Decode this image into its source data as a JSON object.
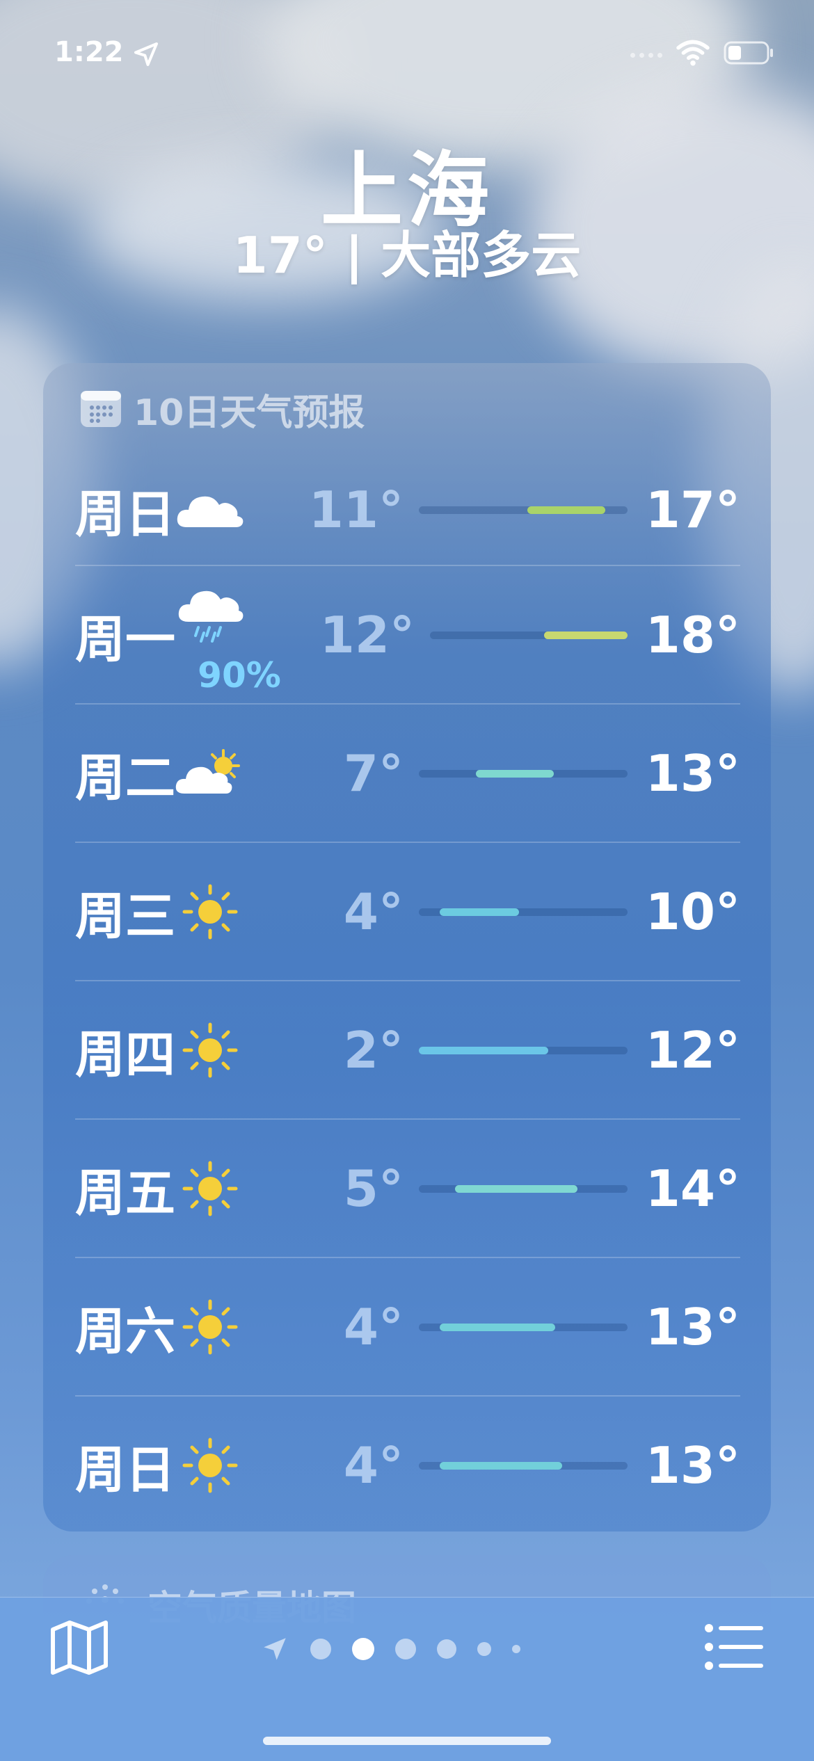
{
  "status_bar": {
    "time": "1:22"
  },
  "header": {
    "city": "上海",
    "condition": "17° | 大部多云"
  },
  "forecast": {
    "title": "10日天气预报",
    "days": [
      {
        "day": "周日",
        "icon": "cloud-icon",
        "precip": "",
        "low": "11°",
        "high": "17°",
        "bar_color": "#a9d36a"
      },
      {
        "day": "周一",
        "icon": "cloud-rain-icon",
        "precip": "90%",
        "low": "12°",
        "high": "18°",
        "bar_color": "#c8d870"
      },
      {
        "day": "周二",
        "icon": "partly-sunny-icon",
        "precip": "",
        "low": "7°",
        "high": "13°",
        "bar_color": "#7fd8cf"
      },
      {
        "day": "周三",
        "icon": "sun-icon",
        "precip": "",
        "low": "4°",
        "high": "10°",
        "bar_color": "#6ccbe0"
      },
      {
        "day": "周四",
        "icon": "sun-icon",
        "precip": "",
        "low": "2°",
        "high": "12°",
        "bar_color": "#6bc6e8"
      },
      {
        "day": "周五",
        "icon": "sun-icon",
        "precip": "",
        "low": "5°",
        "high": "14°",
        "bar_color": "#80d8d2"
      },
      {
        "day": "周六",
        "icon": "sun-icon",
        "precip": "",
        "low": "4°",
        "high": "13°",
        "bar_color": "#72d0da"
      },
      {
        "day": "周日",
        "icon": "sun-icon",
        "precip": "",
        "low": "4°",
        "high": "13°",
        "bar_color": "#72d0da"
      }
    ]
  },
  "next_card": {
    "title": "空气质量地图"
  },
  "pager": {
    "pages": 6,
    "active": 1
  }
}
